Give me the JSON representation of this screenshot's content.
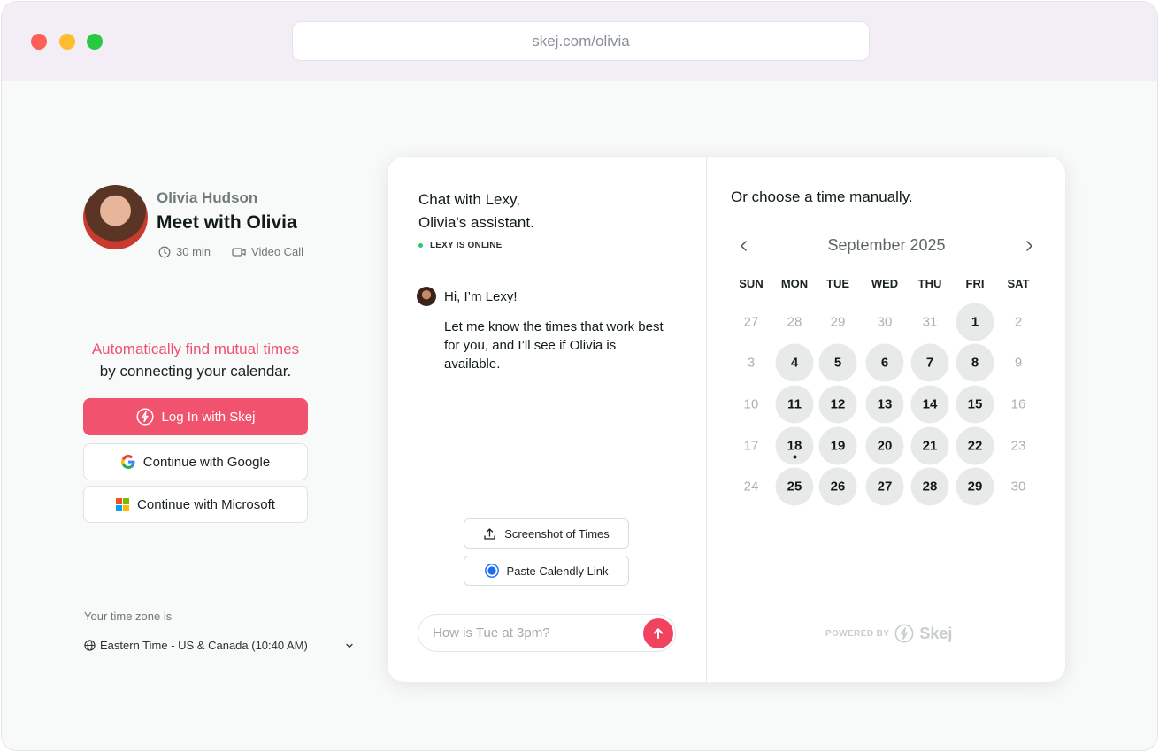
{
  "browser": {
    "url": "skej.com/olivia"
  },
  "host": {
    "name": "Olivia Hudson",
    "meeting_title": "Meet with Olivia",
    "duration": "30 min",
    "meeting_type": "Video Call"
  },
  "connect": {
    "headline": "Automatically find mutual times",
    "subline": "by connecting your calendar.",
    "skej_label": "Log In with Skej",
    "google_label": "Continue with Google",
    "microsoft_label": "Continue with Microsoft"
  },
  "timezone": {
    "label": "Your time zone is",
    "value": "Eastern Time - US & Canada (10:40 AM)"
  },
  "chat": {
    "title_line1": "Chat with Lexy,",
    "title_line2": "Olivia's assistant.",
    "status": "LEXY IS ONLINE",
    "messages": [
      "Hi, I’m Lexy!",
      "Let me know the times that work best for you, and I’ll see if Olivia is available."
    ],
    "quick_actions": [
      "Screenshot of Times",
      "Paste Calendly Link"
    ],
    "input_placeholder": "How is Tue at 3pm?"
  },
  "calendar": {
    "title": "Or choose a time manually.",
    "month": "September 2025",
    "weekdays": [
      "SUN",
      "MON",
      "TUE",
      "WED",
      "THU",
      "FRI",
      "SAT"
    ],
    "weeks": [
      [
        {
          "d": "27",
          "s": "muted"
        },
        {
          "d": "28",
          "s": "muted"
        },
        {
          "d": "29",
          "s": "muted"
        },
        {
          "d": "30",
          "s": "muted"
        },
        {
          "d": "31",
          "s": "muted"
        },
        {
          "d": "1",
          "s": "avail"
        },
        {
          "d": "2",
          "s": "muted"
        }
      ],
      [
        {
          "d": "3",
          "s": "muted"
        },
        {
          "d": "4",
          "s": "avail"
        },
        {
          "d": "5",
          "s": "avail"
        },
        {
          "d": "6",
          "s": "avail"
        },
        {
          "d": "7",
          "s": "avail"
        },
        {
          "d": "8",
          "s": "avail"
        },
        {
          "d": "9",
          "s": "muted"
        }
      ],
      [
        {
          "d": "10",
          "s": "muted"
        },
        {
          "d": "11",
          "s": "avail"
        },
        {
          "d": "12",
          "s": "avail"
        },
        {
          "d": "13",
          "s": "avail"
        },
        {
          "d": "14",
          "s": "avail"
        },
        {
          "d": "15",
          "s": "avail"
        },
        {
          "d": "16",
          "s": "muted"
        }
      ],
      [
        {
          "d": "17",
          "s": "muted"
        },
        {
          "d": "18",
          "s": "avail",
          "today": true
        },
        {
          "d": "19",
          "s": "avail"
        },
        {
          "d": "20",
          "s": "avail"
        },
        {
          "d": "21",
          "s": "avail"
        },
        {
          "d": "22",
          "s": "avail"
        },
        {
          "d": "23",
          "s": "muted"
        }
      ],
      [
        {
          "d": "24",
          "s": "muted"
        },
        {
          "d": "25",
          "s": "avail"
        },
        {
          "d": "26",
          "s": "avail"
        },
        {
          "d": "27",
          "s": "avail"
        },
        {
          "d": "28",
          "s": "avail"
        },
        {
          "d": "29",
          "s": "avail"
        },
        {
          "d": "30",
          "s": "muted"
        }
      ]
    ]
  },
  "footer": {
    "powered_by": "POWERED BY",
    "brand": "Skej"
  },
  "colors": {
    "accent": "#f1536e",
    "online": "#2ac96a",
    "available_day": "#e8eaea"
  }
}
